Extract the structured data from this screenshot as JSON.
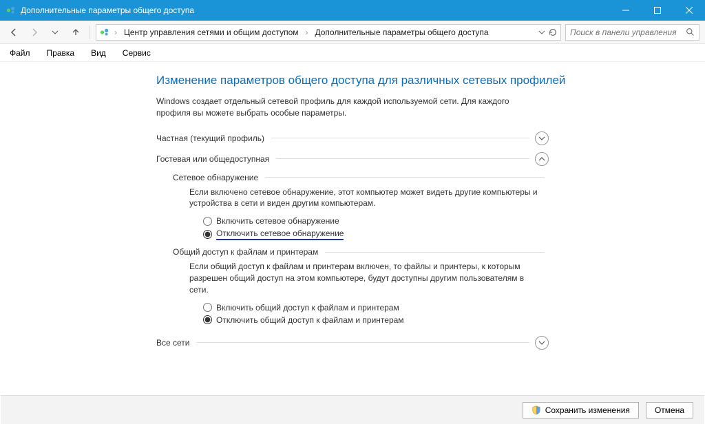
{
  "titlebar": {
    "title": "Дополнительные параметры общего доступа"
  },
  "breadcrumb": {
    "item1": "Центр управления сетями и общим доступом",
    "item2": "Дополнительные параметры общего доступа"
  },
  "search": {
    "placeholder": "Поиск в панели управления"
  },
  "menu": {
    "file": "Файл",
    "edit": "Правка",
    "view": "Вид",
    "service": "Сервис"
  },
  "main": {
    "heading": "Изменение параметров общего доступа для различных сетевых профилей",
    "intro": "Windows создает отдельный сетевой профиль для каждой используемой сети. Для каждого профиля вы можете выбрать особые параметры."
  },
  "profiles": {
    "private": "Частная (текущий профиль)",
    "guest": "Гостевая или общедоступная",
    "all": "Все сети"
  },
  "guest": {
    "discovery": {
      "title": "Сетевое обнаружение",
      "desc": "Если включено сетевое обнаружение, этот компьютер может видеть другие компьютеры и устройства в сети и виден другим компьютерам.",
      "radio_on": "Включить сетевое обнаружение",
      "radio_off": "Отключить сетевое обнаружение"
    },
    "sharing": {
      "title": "Общий доступ к файлам и принтерам",
      "desc": "Если общий доступ к файлам и принтерам включен, то файлы и принтеры, к которым разрешен общий доступ на этом компьютере, будут доступны другим пользователям в сети.",
      "radio_on": "Включить общий доступ к файлам и принтерам",
      "radio_off": "Отключить общий доступ к файлам и принтерам"
    }
  },
  "footer": {
    "save": "Сохранить изменения",
    "cancel": "Отмена"
  }
}
